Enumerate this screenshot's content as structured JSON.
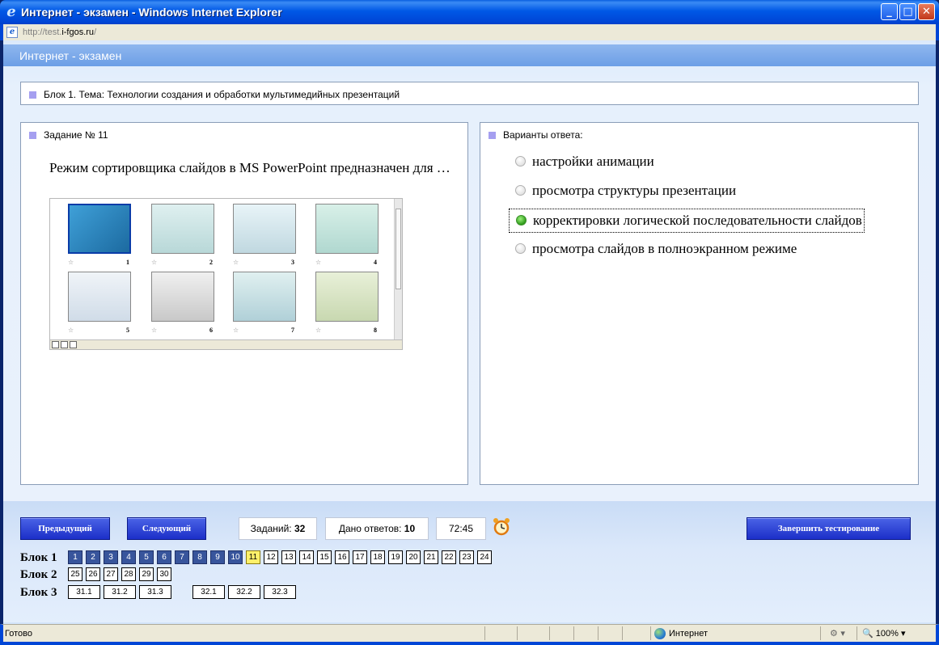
{
  "window": {
    "title": "Интернет - экзамен - Windows Internet Explorer",
    "url_prefix": "http://test.",
    "url_domain": "i-fgos.ru",
    "url_suffix": "/",
    "buttons": {
      "minimize": "_",
      "maximize": "□",
      "close": "✕"
    }
  },
  "app": {
    "title": "Интернет - экзамен"
  },
  "block_header": "Блок 1. Тема: Технологии создания и обработки мультимедийных презентаций",
  "task": {
    "header": "Задание № 11",
    "question": "Режим сортировщика слайдов в MS PowerPoint предназначен для …",
    "slides": [
      "1",
      "2",
      "3",
      "4",
      "5",
      "6",
      "7",
      "8"
    ]
  },
  "answers": {
    "header": "Варианты ответа:",
    "options": [
      {
        "label": "настройки анимации",
        "selected": false
      },
      {
        "label": "просмотра структуры презентации",
        "selected": false
      },
      {
        "label": "корректировки логической последовательности слайдов",
        "selected": true
      },
      {
        "label": "просмотра слайдов в полноэкранном режиме",
        "selected": false
      }
    ]
  },
  "toolbar": {
    "prev_label": "Предыдущий",
    "next_label": "Следующий",
    "tasks_label": "Заданий:",
    "tasks_value": "32",
    "answered_label": "Дано ответов:",
    "answered_value": "10",
    "timer": "72:45",
    "finish_label": "Завершить тестирование"
  },
  "navigation": {
    "blocks": [
      {
        "label": "Блок 1",
        "items": [
          "1",
          "2",
          "3",
          "4",
          "5",
          "6",
          "7",
          "8",
          "9",
          "10",
          "11",
          "12",
          "13",
          "14",
          "15",
          "16",
          "17",
          "18",
          "19",
          "20",
          "21",
          "22",
          "23",
          "24"
        ],
        "done_count": 10,
        "current": "11"
      },
      {
        "label": "Блок 2",
        "items": [
          "25",
          "26",
          "27",
          "28",
          "29",
          "30"
        ],
        "done_count": 0,
        "current": ""
      },
      {
        "label": "Блок 3",
        "items": [
          "31.1",
          "31.2",
          "31.3",
          "32.1",
          "32.2",
          "32.3"
        ],
        "done_count": 0,
        "current": ""
      }
    ]
  },
  "status": {
    "text": "Готово",
    "zone": "Интернет",
    "zoom": "100%"
  },
  "colors": {
    "accent": "#1c2fc8",
    "done_cell": "#38559c",
    "current_cell": "#fff06a",
    "selected_radio": "#2e9a1a"
  }
}
